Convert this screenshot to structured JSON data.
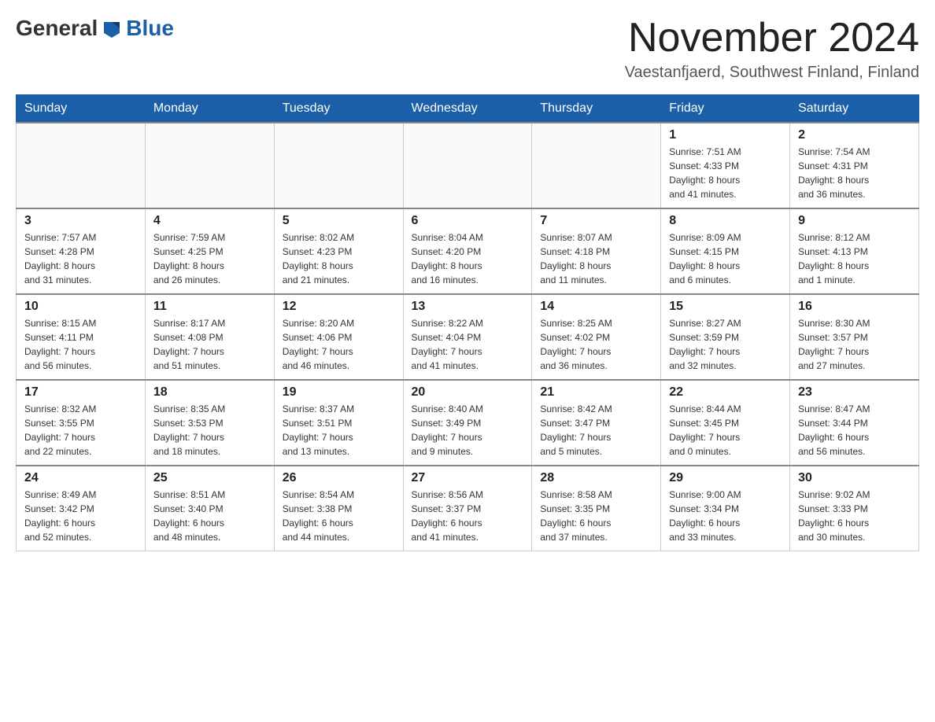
{
  "header": {
    "logo_general": "General",
    "logo_blue": "Blue",
    "month_title": "November 2024",
    "location": "Vaestanfjaerd, Southwest Finland, Finland"
  },
  "weekdays": [
    "Sunday",
    "Monday",
    "Tuesday",
    "Wednesday",
    "Thursday",
    "Friday",
    "Saturday"
  ],
  "weeks": [
    [
      {
        "day": "",
        "info": ""
      },
      {
        "day": "",
        "info": ""
      },
      {
        "day": "",
        "info": ""
      },
      {
        "day": "",
        "info": ""
      },
      {
        "day": "",
        "info": ""
      },
      {
        "day": "1",
        "info": "Sunrise: 7:51 AM\nSunset: 4:33 PM\nDaylight: 8 hours\nand 41 minutes."
      },
      {
        "day": "2",
        "info": "Sunrise: 7:54 AM\nSunset: 4:31 PM\nDaylight: 8 hours\nand 36 minutes."
      }
    ],
    [
      {
        "day": "3",
        "info": "Sunrise: 7:57 AM\nSunset: 4:28 PM\nDaylight: 8 hours\nand 31 minutes."
      },
      {
        "day": "4",
        "info": "Sunrise: 7:59 AM\nSunset: 4:25 PM\nDaylight: 8 hours\nand 26 minutes."
      },
      {
        "day": "5",
        "info": "Sunrise: 8:02 AM\nSunset: 4:23 PM\nDaylight: 8 hours\nand 21 minutes."
      },
      {
        "day": "6",
        "info": "Sunrise: 8:04 AM\nSunset: 4:20 PM\nDaylight: 8 hours\nand 16 minutes."
      },
      {
        "day": "7",
        "info": "Sunrise: 8:07 AM\nSunset: 4:18 PM\nDaylight: 8 hours\nand 11 minutes."
      },
      {
        "day": "8",
        "info": "Sunrise: 8:09 AM\nSunset: 4:15 PM\nDaylight: 8 hours\nand 6 minutes."
      },
      {
        "day": "9",
        "info": "Sunrise: 8:12 AM\nSunset: 4:13 PM\nDaylight: 8 hours\nand 1 minute."
      }
    ],
    [
      {
        "day": "10",
        "info": "Sunrise: 8:15 AM\nSunset: 4:11 PM\nDaylight: 7 hours\nand 56 minutes."
      },
      {
        "day": "11",
        "info": "Sunrise: 8:17 AM\nSunset: 4:08 PM\nDaylight: 7 hours\nand 51 minutes."
      },
      {
        "day": "12",
        "info": "Sunrise: 8:20 AM\nSunset: 4:06 PM\nDaylight: 7 hours\nand 46 minutes."
      },
      {
        "day": "13",
        "info": "Sunrise: 8:22 AM\nSunset: 4:04 PM\nDaylight: 7 hours\nand 41 minutes."
      },
      {
        "day": "14",
        "info": "Sunrise: 8:25 AM\nSunset: 4:02 PM\nDaylight: 7 hours\nand 36 minutes."
      },
      {
        "day": "15",
        "info": "Sunrise: 8:27 AM\nSunset: 3:59 PM\nDaylight: 7 hours\nand 32 minutes."
      },
      {
        "day": "16",
        "info": "Sunrise: 8:30 AM\nSunset: 3:57 PM\nDaylight: 7 hours\nand 27 minutes."
      }
    ],
    [
      {
        "day": "17",
        "info": "Sunrise: 8:32 AM\nSunset: 3:55 PM\nDaylight: 7 hours\nand 22 minutes."
      },
      {
        "day": "18",
        "info": "Sunrise: 8:35 AM\nSunset: 3:53 PM\nDaylight: 7 hours\nand 18 minutes."
      },
      {
        "day": "19",
        "info": "Sunrise: 8:37 AM\nSunset: 3:51 PM\nDaylight: 7 hours\nand 13 minutes."
      },
      {
        "day": "20",
        "info": "Sunrise: 8:40 AM\nSunset: 3:49 PM\nDaylight: 7 hours\nand 9 minutes."
      },
      {
        "day": "21",
        "info": "Sunrise: 8:42 AM\nSunset: 3:47 PM\nDaylight: 7 hours\nand 5 minutes."
      },
      {
        "day": "22",
        "info": "Sunrise: 8:44 AM\nSunset: 3:45 PM\nDaylight: 7 hours\nand 0 minutes."
      },
      {
        "day": "23",
        "info": "Sunrise: 8:47 AM\nSunset: 3:44 PM\nDaylight: 6 hours\nand 56 minutes."
      }
    ],
    [
      {
        "day": "24",
        "info": "Sunrise: 8:49 AM\nSunset: 3:42 PM\nDaylight: 6 hours\nand 52 minutes."
      },
      {
        "day": "25",
        "info": "Sunrise: 8:51 AM\nSunset: 3:40 PM\nDaylight: 6 hours\nand 48 minutes."
      },
      {
        "day": "26",
        "info": "Sunrise: 8:54 AM\nSunset: 3:38 PM\nDaylight: 6 hours\nand 44 minutes."
      },
      {
        "day": "27",
        "info": "Sunrise: 8:56 AM\nSunset: 3:37 PM\nDaylight: 6 hours\nand 41 minutes."
      },
      {
        "day": "28",
        "info": "Sunrise: 8:58 AM\nSunset: 3:35 PM\nDaylight: 6 hours\nand 37 minutes."
      },
      {
        "day": "29",
        "info": "Sunrise: 9:00 AM\nSunset: 3:34 PM\nDaylight: 6 hours\nand 33 minutes."
      },
      {
        "day": "30",
        "info": "Sunrise: 9:02 AM\nSunset: 3:33 PM\nDaylight: 6 hours\nand 30 minutes."
      }
    ]
  ]
}
